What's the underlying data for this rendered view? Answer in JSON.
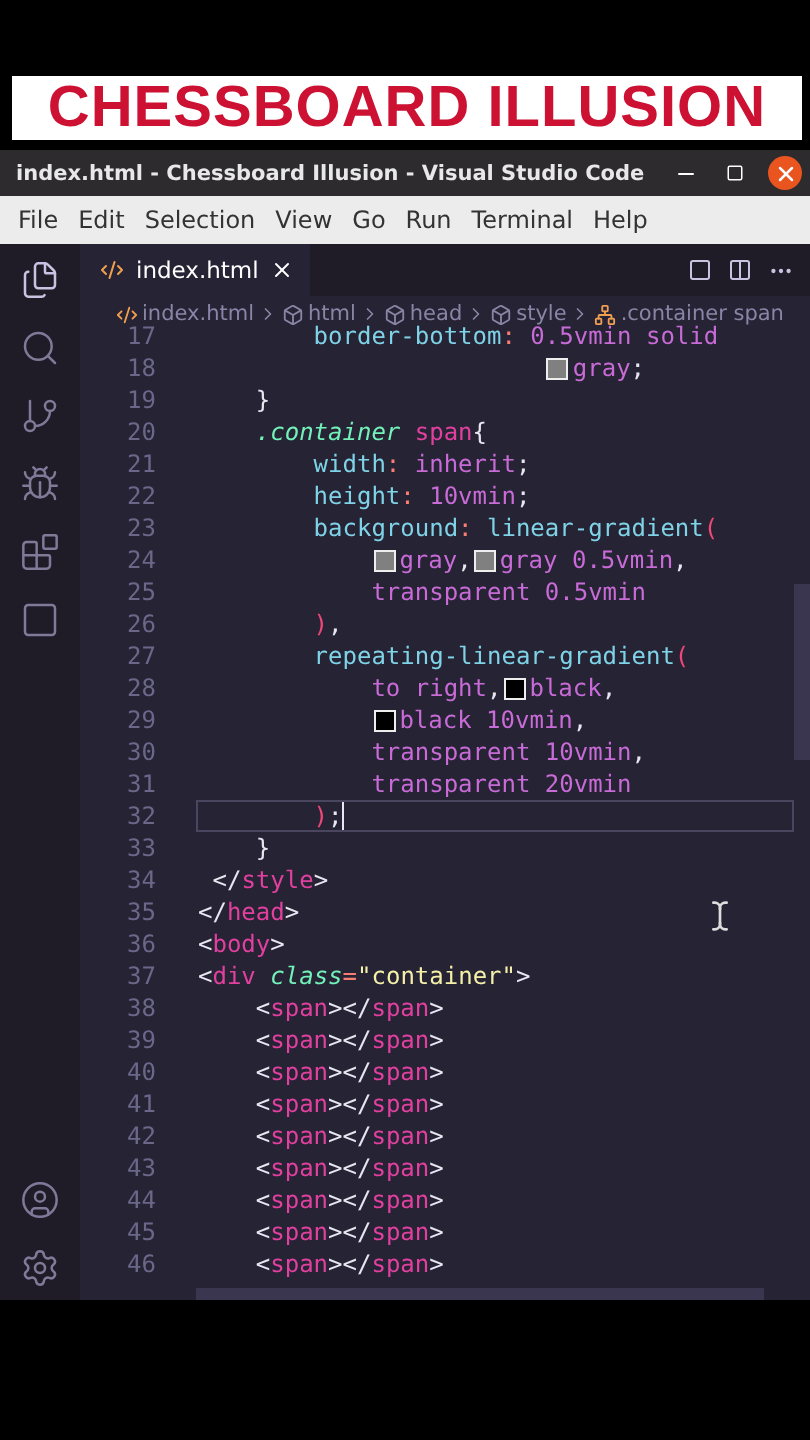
{
  "banner": {
    "title": "CHESSBOARD ILLUSION"
  },
  "window": {
    "title": "index.html - Chessboard Illusion - Visual Studio Code"
  },
  "menu": [
    "File",
    "Edit",
    "Selection",
    "View",
    "Go",
    "Run",
    "Terminal",
    "Help"
  ],
  "activity_bar": {
    "top": [
      {
        "kind": "files",
        "selected": true
      },
      {
        "kind": "search",
        "selected": false
      },
      {
        "kind": "source-control",
        "selected": false
      },
      {
        "kind": "run",
        "selected": false
      },
      {
        "kind": "extensions",
        "selected": false
      },
      {
        "kind": "remote",
        "selected": false
      }
    ],
    "bottom": [
      {
        "kind": "account"
      },
      {
        "kind": "settings"
      }
    ]
  },
  "tabs": [
    {
      "label": "index.html",
      "selected": true
    }
  ],
  "breadcrumbs": [
    {
      "kind": "file",
      "label": "index.html"
    },
    {
      "kind": "element",
      "label": "html"
    },
    {
      "kind": "element",
      "label": "head"
    },
    {
      "kind": "element",
      "label": "style"
    },
    {
      "kind": "selector",
      "label": ".container span"
    }
  ],
  "code_lines": [
    {
      "number": "17",
      "current": false,
      "tokens": [
        {
          "kind": "prop",
          "text": "        border-bottom"
        },
        {
          "kind": "punct",
          "text": ": "
        },
        {
          "kind": "value",
          "text": "0.5vmin solid"
        }
      ]
    },
    {
      "number": "18",
      "current": false,
      "tokens": [
        {
          "kind": "value",
          "text": "                        gray",
          "color": "#808080"
        },
        {
          "kind": "plain",
          "text": ";"
        }
      ]
    },
    {
      "number": "19",
      "current": false,
      "tokens": [
        {
          "kind": "plain",
          "text": "    }"
        }
      ]
    },
    {
      "number": "20",
      "current": false,
      "tokens": [
        {
          "kind": "class",
          "text": "    .container"
        },
        {
          "kind": "tag",
          "text": " span"
        },
        {
          "kind": "plain",
          "text": "{"
        }
      ]
    },
    {
      "number": "21",
      "current": false,
      "tokens": [
        {
          "kind": "prop",
          "text": "        width"
        },
        {
          "kind": "punct",
          "text": ": "
        },
        {
          "kind": "value",
          "text": "inherit"
        },
        {
          "kind": "plain",
          "text": ";"
        }
      ]
    },
    {
      "number": "22",
      "current": false,
      "tokens": [
        {
          "kind": "prop",
          "text": "        height"
        },
        {
          "kind": "punct",
          "text": ": "
        },
        {
          "kind": "value",
          "text": "10vmin"
        },
        {
          "kind": "plain",
          "text": ";"
        }
      ]
    },
    {
      "number": "23",
      "current": false,
      "tokens": [
        {
          "kind": "prop",
          "text": "        background"
        },
        {
          "kind": "punct",
          "text": ": "
        },
        {
          "kind": "prop",
          "text": "linear-gradient"
        },
        {
          "kind": "paren",
          "text": "("
        }
      ]
    },
    {
      "number": "24",
      "current": false,
      "tokens": [
        {
          "kind": "value",
          "text": "            gray",
          "color": "#808080"
        },
        {
          "kind": "plain",
          "text": ","
        },
        {
          "kind": "value",
          "text": "gray 0.5vmin",
          "color": "#808080"
        },
        {
          "kind": "plain",
          "text": ","
        }
      ]
    },
    {
      "number": "25",
      "current": false,
      "tokens": [
        {
          "kind": "value",
          "text": "            transparent 0.5vmin"
        }
      ]
    },
    {
      "number": "26",
      "current": false,
      "tokens": [
        {
          "kind": "paren",
          "text": "        )"
        },
        {
          "kind": "plain",
          "text": ","
        }
      ]
    },
    {
      "number": "27",
      "current": false,
      "tokens": [
        {
          "kind": "prop",
          "text": "        repeating-linear-gradient"
        },
        {
          "kind": "paren",
          "text": "("
        }
      ]
    },
    {
      "number": "28",
      "current": false,
      "tokens": [
        {
          "kind": "value",
          "text": "            to right"
        },
        {
          "kind": "plain",
          "text": ","
        },
        {
          "kind": "value",
          "text": "black",
          "color": "#000000"
        },
        {
          "kind": "plain",
          "text": ","
        }
      ]
    },
    {
      "number": "29",
      "current": false,
      "tokens": [
        {
          "kind": "value",
          "text": "            black 10vmin",
          "color": "#000000"
        },
        {
          "kind": "plain",
          "text": ","
        }
      ]
    },
    {
      "number": "30",
      "current": false,
      "tokens": [
        {
          "kind": "value",
          "text": "            transparent 10vmin"
        },
        {
          "kind": "plain",
          "text": ","
        }
      ]
    },
    {
      "number": "31",
      "current": false,
      "tokens": [
        {
          "kind": "value",
          "text": "            transparent 20vmin"
        }
      ]
    },
    {
      "number": "32",
      "current": true,
      "tokens": [
        {
          "kind": "paren",
          "text": "        )"
        },
        {
          "kind": "plain",
          "text": ";"
        }
      ]
    },
    {
      "number": "33",
      "current": false,
      "tokens": [
        {
          "kind": "plain",
          "text": "    }"
        }
      ]
    },
    {
      "number": "34",
      "current": false,
      "tokens": [
        {
          "kind": "plain",
          "text": " </"
        },
        {
          "kind": "tag",
          "text": "style"
        },
        {
          "kind": "plain",
          "text": ">"
        }
      ]
    },
    {
      "number": "35",
      "current": false,
      "tokens": [
        {
          "kind": "plain",
          "text": "</"
        },
        {
          "kind": "tag",
          "text": "head"
        },
        {
          "kind": "plain",
          "text": ">"
        }
      ]
    },
    {
      "number": "36",
      "current": false,
      "tokens": [
        {
          "kind": "plain",
          "text": "<"
        },
        {
          "kind": "tag",
          "text": "body"
        },
        {
          "kind": "plain",
          "text": ">"
        }
      ]
    },
    {
      "number": "37",
      "current": false,
      "tokens": [
        {
          "kind": "plain",
          "text": "<"
        },
        {
          "kind": "tag",
          "text": "div"
        },
        {
          "kind": "attr",
          "text": " class"
        },
        {
          "kind": "punct",
          "text": "="
        },
        {
          "kind": "string",
          "text": "\"container\""
        },
        {
          "kind": "plain",
          "text": ">"
        }
      ]
    },
    {
      "number": "38",
      "current": false,
      "tokens": [
        {
          "kind": "plain",
          "text": "    <"
        },
        {
          "kind": "tag",
          "text": "span"
        },
        {
          "kind": "plain",
          "text": "></"
        },
        {
          "kind": "tag",
          "text": "span"
        },
        {
          "kind": "plain",
          "text": ">"
        }
      ]
    },
    {
      "number": "39",
      "current": false,
      "tokens": [
        {
          "kind": "plain",
          "text": "    <"
        },
        {
          "kind": "tag",
          "text": "span"
        },
        {
          "kind": "plain",
          "text": "></"
        },
        {
          "kind": "tag",
          "text": "span"
        },
        {
          "kind": "plain",
          "text": ">"
        }
      ]
    },
    {
      "number": "40",
      "current": false,
      "tokens": [
        {
          "kind": "plain",
          "text": "    <"
        },
        {
          "kind": "tag",
          "text": "span"
        },
        {
          "kind": "plain",
          "text": "></"
        },
        {
          "kind": "tag",
          "text": "span"
        },
        {
          "kind": "plain",
          "text": ">"
        }
      ]
    },
    {
      "number": "41",
      "current": false,
      "tokens": [
        {
          "kind": "plain",
          "text": "    <"
        },
        {
          "kind": "tag",
          "text": "span"
        },
        {
          "kind": "plain",
          "text": "></"
        },
        {
          "kind": "tag",
          "text": "span"
        },
        {
          "kind": "plain",
          "text": ">"
        }
      ]
    },
    {
      "number": "42",
      "current": false,
      "tokens": [
        {
          "kind": "plain",
          "text": "    <"
        },
        {
          "kind": "tag",
          "text": "span"
        },
        {
          "kind": "plain",
          "text": "></"
        },
        {
          "kind": "tag",
          "text": "span"
        },
        {
          "kind": "plain",
          "text": ">"
        }
      ]
    },
    {
      "number": "43",
      "current": false,
      "tokens": [
        {
          "kind": "plain",
          "text": "    <"
        },
        {
          "kind": "tag",
          "text": "span"
        },
        {
          "kind": "plain",
          "text": "></"
        },
        {
          "kind": "tag",
          "text": "span"
        },
        {
          "kind": "plain",
          "text": ">"
        }
      ]
    },
    {
      "number": "44",
      "current": false,
      "tokens": [
        {
          "kind": "plain",
          "text": "    <"
        },
        {
          "kind": "tag",
          "text": "span"
        },
        {
          "kind": "plain",
          "text": "></"
        },
        {
          "kind": "tag",
          "text": "span"
        },
        {
          "kind": "plain",
          "text": ">"
        }
      ]
    },
    {
      "number": "45",
      "current": false,
      "tokens": [
        {
          "kind": "plain",
          "text": "    <"
        },
        {
          "kind": "tag",
          "text": "span"
        },
        {
          "kind": "plain",
          "text": "></"
        },
        {
          "kind": "tag",
          "text": "span"
        },
        {
          "kind": "plain",
          "text": ">"
        }
      ]
    },
    {
      "number": "46",
      "current": false,
      "tokens": [
        {
          "kind": "plain",
          "text": "    <"
        },
        {
          "kind": "tag",
          "text": "span"
        },
        {
          "kind": "plain",
          "text": "></"
        },
        {
          "kind": "tag",
          "text": "span"
        },
        {
          "kind": "plain",
          "text": ">"
        }
      ]
    }
  ]
}
